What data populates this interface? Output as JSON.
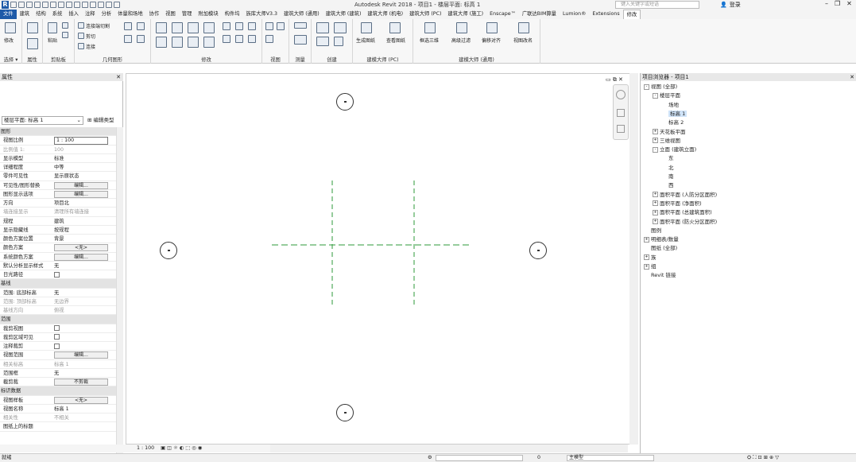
{
  "titlebar": {
    "title": "Autodesk Revit 2018 -   项目1 - 楼层平面: 标高 1",
    "search_placeholder": "键入关键字或短语",
    "login": "登录",
    "logo": "R"
  },
  "tabs": [
    "文件",
    "建筑",
    "结构",
    "系统",
    "插入",
    "注释",
    "分析",
    "体量和场地",
    "协作",
    "视图",
    "管理",
    "附加模块",
    "构件坞",
    "族库大师V3.3",
    "建筑大师 (通用)",
    "建筑大师 (建筑)",
    "建筑大师 (机电)",
    "建筑大师 (PC)",
    "建筑大师 (施工)",
    "Enscape™",
    "广联达BIM算量",
    "Lumion®",
    "Extensions",
    "修改"
  ],
  "active_tab": "修改",
  "ribbon": {
    "select": {
      "modify": "修改",
      "label": "选择 ▾"
    },
    "properties": {
      "label": "属性"
    },
    "clipboard": {
      "paste": "粘贴",
      "label": "剪贴板"
    },
    "geometry": {
      "join_cut": "连接端切割",
      "cut": "剪切",
      "join": "连接",
      "label": "几何图形"
    },
    "modify": {
      "label": "修改"
    },
    "view": {
      "label": "视图"
    },
    "measure": {
      "label": "测量"
    },
    "create": {
      "label": "创建"
    },
    "pc": {
      "gen_drawing": "生成图纸",
      "view_drawing": "查看图纸",
      "label": "建模大师 (PC)"
    },
    "general": {
      "box3d": "框选三维",
      "adv_filter": "高级过滤",
      "align": "偏移对齐",
      "rename": "视图改名",
      "label": "建模大师 (通用)"
    }
  },
  "properties": {
    "header": "属性",
    "type_selector": "楼层平面: 标高 1",
    "edit_type": "编辑类型",
    "rows": [
      {
        "k": "图形",
        "v": "",
        "kind": "group"
      },
      {
        "k": "视图比例",
        "v": "1 : 100",
        "kind": "input"
      },
      {
        "k": "比例值 1:",
        "v": "100",
        "kind": "dim"
      },
      {
        "k": "显示模型",
        "v": "标准",
        "kind": "text"
      },
      {
        "k": "详细程度",
        "v": "中等",
        "kind": "text"
      },
      {
        "k": "零件可见性",
        "v": "显示原状态",
        "kind": "text"
      },
      {
        "k": "可见性/图形替换",
        "v": "编辑...",
        "kind": "button"
      },
      {
        "k": "图形显示选项",
        "v": "编辑...",
        "kind": "button"
      },
      {
        "k": "方向",
        "v": "项目北",
        "kind": "text"
      },
      {
        "k": "墙连接显示",
        "v": "清理所有墙连接",
        "kind": "dim"
      },
      {
        "k": "规程",
        "v": "建筑",
        "kind": "text"
      },
      {
        "k": "显示隐藏线",
        "v": "按规程",
        "kind": "text"
      },
      {
        "k": "颜色方案位置",
        "v": "背景",
        "kind": "text"
      },
      {
        "k": "颜色方案",
        "v": "<无>",
        "kind": "button"
      },
      {
        "k": "系统颜色方案",
        "v": "编辑...",
        "kind": "button"
      },
      {
        "k": "默认分析显示样式",
        "v": "无",
        "kind": "text"
      },
      {
        "k": "日光路径",
        "v": "",
        "kind": "check"
      },
      {
        "k": "基线",
        "v": "",
        "kind": "group"
      },
      {
        "k": "范围: 底部标高",
        "v": "无",
        "kind": "text"
      },
      {
        "k": "范围: 顶部标高",
        "v": "无边界",
        "kind": "dim"
      },
      {
        "k": "基线方向",
        "v": "俯视",
        "kind": "dim"
      },
      {
        "k": "范围",
        "v": "",
        "kind": "group"
      },
      {
        "k": "裁剪视图",
        "v": "",
        "kind": "check"
      },
      {
        "k": "裁剪区域可见",
        "v": "",
        "kind": "check"
      },
      {
        "k": "注释裁剪",
        "v": "",
        "kind": "check"
      },
      {
        "k": "视图范围",
        "v": "编辑...",
        "kind": "button"
      },
      {
        "k": "相关标高",
        "v": "标高 1",
        "kind": "dim"
      },
      {
        "k": "范围框",
        "v": "无",
        "kind": "text"
      },
      {
        "k": "截剪裁",
        "v": "不剪裁",
        "kind": "button"
      },
      {
        "k": "标识数据",
        "v": "",
        "kind": "group"
      },
      {
        "k": "视图样板",
        "v": "<无>",
        "kind": "button"
      },
      {
        "k": "视图名称",
        "v": "标高 1",
        "kind": "text"
      },
      {
        "k": "相关性",
        "v": "不相关",
        "kind": "dim"
      },
      {
        "k": "图纸上的标题",
        "v": "",
        "kind": "text"
      }
    ]
  },
  "project_browser": {
    "header": "项目浏览器 - 项目1",
    "items": [
      {
        "label": "视图 (全部)",
        "level": 0,
        "toggle": "-"
      },
      {
        "label": "楼层平面",
        "level": 1,
        "toggle": "-"
      },
      {
        "label": "场地",
        "level": 2,
        "toggle": ""
      },
      {
        "label": "标高 1",
        "level": 2,
        "toggle": "",
        "selected": true
      },
      {
        "label": "标高 2",
        "level": 2,
        "toggle": ""
      },
      {
        "label": "天花板平面",
        "level": 1,
        "toggle": "+"
      },
      {
        "label": "三维视图",
        "level": 1,
        "toggle": "+"
      },
      {
        "label": "立面 (建筑立面)",
        "level": 1,
        "toggle": "-"
      },
      {
        "label": "东",
        "level": 2,
        "toggle": ""
      },
      {
        "label": "北",
        "level": 2,
        "toggle": ""
      },
      {
        "label": "南",
        "level": 2,
        "toggle": ""
      },
      {
        "label": "西",
        "level": 2,
        "toggle": ""
      },
      {
        "label": "面积平面 (人防分区面积)",
        "level": 1,
        "toggle": "+"
      },
      {
        "label": "面积平面 (净面积)",
        "level": 1,
        "toggle": "+"
      },
      {
        "label": "面积平面 (总建筑面积)",
        "level": 1,
        "toggle": "+"
      },
      {
        "label": "面积平面 (防火分区面积)",
        "level": 1,
        "toggle": "+"
      },
      {
        "label": "图例",
        "level": 0,
        "toggle": ""
      },
      {
        "label": "明细表/数量",
        "level": 0,
        "toggle": "+"
      },
      {
        "label": "图纸 (全部)",
        "level": 0,
        "toggle": ""
      },
      {
        "label": "族",
        "level": 0,
        "toggle": "+"
      },
      {
        "label": "组",
        "level": 0,
        "toggle": "+"
      },
      {
        "label": "Revit 链接",
        "level": 0,
        "toggle": ""
      }
    ]
  },
  "view_control": {
    "scale": "1 : 100"
  },
  "status": {
    "left": "就绪",
    "model": "主模型",
    "filter": "0"
  },
  "colors": {
    "accent": "#1e5aa8",
    "grid_dash": "#2e9a3a",
    "selection": "#cfe3f8"
  }
}
